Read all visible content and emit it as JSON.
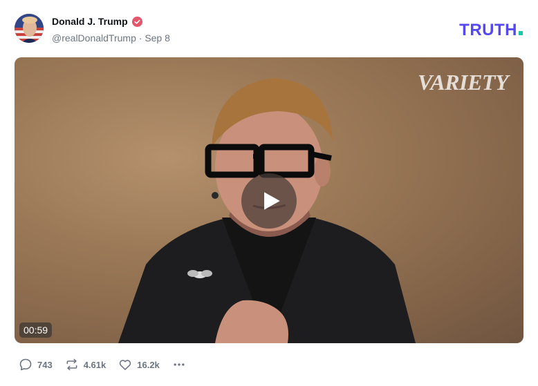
{
  "post": {
    "author_name": "Donald J. Trump",
    "handle": "@realDonaldTrump",
    "separator": "·",
    "date": "Sep 8",
    "verified": true
  },
  "brand": {
    "logo_text": "TRUTH",
    "logo_color": "#5448ee",
    "dot_color": "#18c6a9"
  },
  "video": {
    "watermark": "VARIETY",
    "duration": "00:59",
    "play_icon": "play-icon"
  },
  "actions": {
    "replies": "743",
    "retruths": "4.61k",
    "likes": "16.2k",
    "more_icon": "more-icon"
  }
}
